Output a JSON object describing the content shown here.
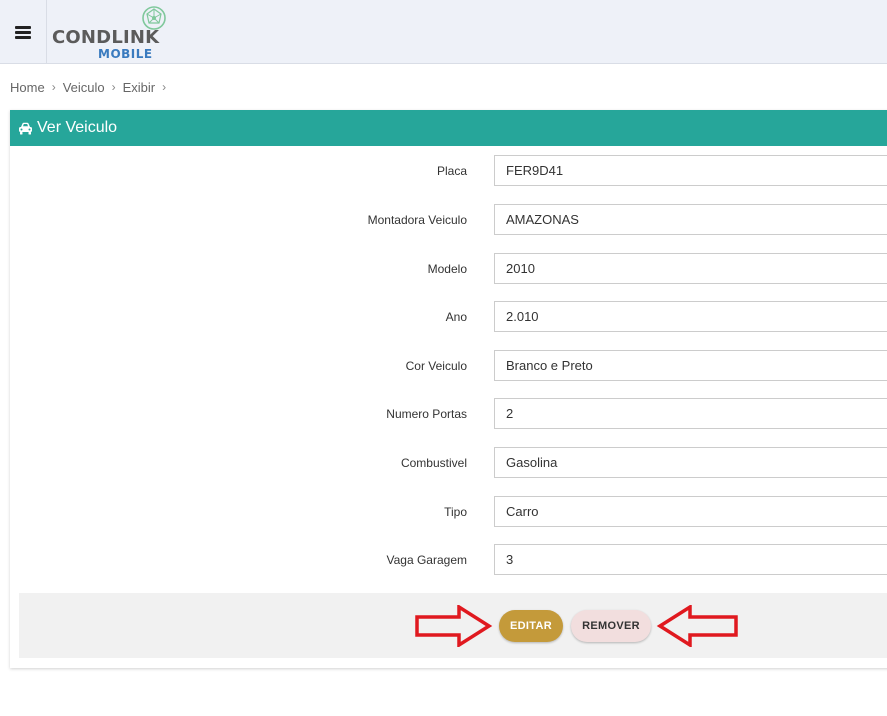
{
  "header": {
    "logo_text": "CONDLINK",
    "logo_sub": "MOBILE"
  },
  "breadcrumb": [
    "Home",
    "Veiculo",
    "Exibir"
  ],
  "card": {
    "title": "Ver Veiculo",
    "icon": "car-icon"
  },
  "fields": [
    {
      "label": "Placa",
      "value": "FER9D41"
    },
    {
      "label": "Montadora Veiculo",
      "value": "AMAZONAS"
    },
    {
      "label": "Modelo",
      "value": "2010"
    },
    {
      "label": "Ano",
      "value": "2.010"
    },
    {
      "label": "Cor Veiculo",
      "value": "Branco e Preto"
    },
    {
      "label": "Numero Portas",
      "value": "2"
    },
    {
      "label": "Combustivel",
      "value": "Gasolina"
    },
    {
      "label": "Tipo",
      "value": "Carro"
    },
    {
      "label": "Vaga Garagem",
      "value": "3"
    }
  ],
  "actions": {
    "edit_label": "EDITAR",
    "remove_label": "REMOVER"
  },
  "colors": {
    "header_accent": "#26a69a",
    "edit_button": "#c49a3a",
    "remove_button": "#f2dede",
    "annotation_arrow": "#e0191f"
  }
}
